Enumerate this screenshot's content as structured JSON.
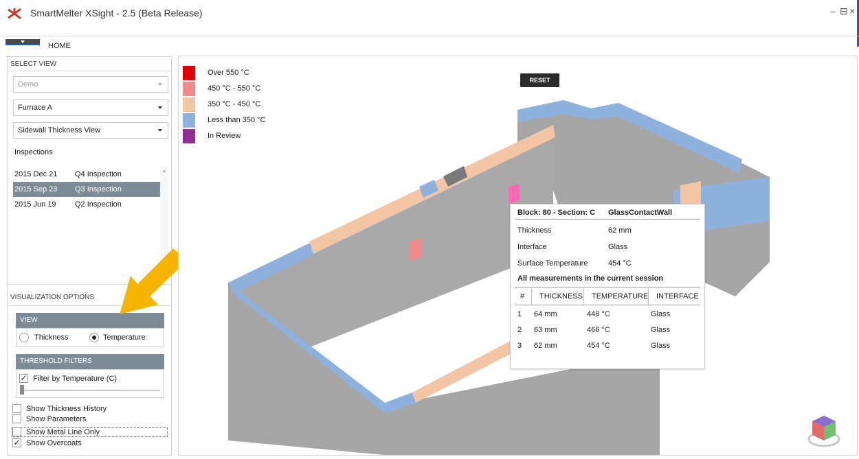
{
  "window": {
    "title": "SmartMelter XSight - 2.5 (Beta Release)",
    "minimize": "–",
    "restore": "ᵈ",
    "close": "×"
  },
  "menu": {
    "home": "HOME"
  },
  "select_view": {
    "header": "SELECT VIEW",
    "plant": "Demo",
    "furnace": "Furnace A",
    "view": "Sidewall Thickness View",
    "inspections_label": "Inspections",
    "inspections": [
      {
        "date": "2015 Dec 21",
        "name": "Q4 Inspection",
        "selected": false
      },
      {
        "date": "2015 Sep 23",
        "name": "Q3 Inspection",
        "selected": true
      },
      {
        "date": "2015 Jun 19",
        "name": "Q2 Inspection",
        "selected": false
      }
    ]
  },
  "visualization": {
    "header": "VISUALIZATION OPTIONS",
    "view_header": "VIEW",
    "thickness": "Thickness",
    "temperature": "Temperature",
    "selected_view": "Temperature",
    "threshold_header": "THRESHOLD FILTERS",
    "filter_label": "Filter by Temperature (C)",
    "filter_checked": true,
    "slider_value": 0.0,
    "options": [
      {
        "label": "Show Thickness History",
        "checked": false
      },
      {
        "label": "Show Parameters",
        "checked": false
      },
      {
        "label": "Show Metal Line Only",
        "checked": false
      },
      {
        "label": "Show Overcoats",
        "checked": true
      }
    ]
  },
  "legend": [
    {
      "label": "Over 550 °C",
      "color": "#e00000"
    },
    {
      "label": "450 °C - 550 °C",
      "color": "#f08c8c"
    },
    {
      "label": "350 °C - 450 °C",
      "color": "#f2c5a5"
    },
    {
      "label": "Less than 350 °C",
      "color": "#8fb1dd"
    },
    {
      "label": "In Review",
      "color": "#8e2e93"
    }
  ],
  "reset": "RESET",
  "popup": {
    "block": "Block: 80 - Section: C",
    "wall": "GlassContactWall",
    "rows": [
      {
        "label": "Thickness",
        "value": "62 mm"
      },
      {
        "label": "Interface",
        "value": "Glass"
      },
      {
        "label": "Surface Temperature",
        "value": "454 °C"
      }
    ],
    "subheader": "All measurements in the current session",
    "columns": [
      "#",
      "THICKNESS",
      "TEMPERATURE",
      "INTERFACE"
    ],
    "measurements": [
      [
        "1",
        "64 mm",
        "448 °C",
        "Glass"
      ],
      [
        "2",
        "63 mm",
        "466 °C",
        "Glass"
      ],
      [
        "3",
        "62 mm",
        "454 °C",
        "Glass"
      ]
    ]
  },
  "colors": {
    "accent": "#1f5fa8",
    "selected_row": "#7d8b96",
    "wall_gray": "#a6a6a6",
    "arrow_orange": "#f5b400"
  },
  "icons": [
    "app-logo-icon",
    "menu-dropdown-icon",
    "chevron-down-icon",
    "checkmark-icon",
    "pointer-arrow-icon",
    "nav-cube-icon"
  ]
}
